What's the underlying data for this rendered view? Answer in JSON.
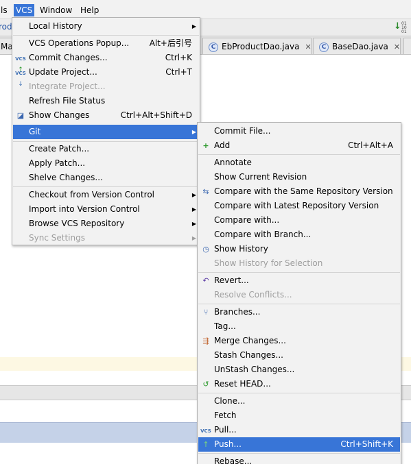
{
  "menubar": {
    "items": [
      "ls",
      "VCS",
      "Window",
      "Help"
    ]
  },
  "tabs": [
    {
      "label": "Ma"
    },
    {
      "label": "EbProductDao.java"
    },
    {
      "label": "BaseDao.java"
    }
  ],
  "toolbar": {
    "partial_label": "rod"
  },
  "vcs_menu": {
    "local_history": "Local History",
    "vcs_operations_popup": "VCS Operations Popup...",
    "vcs_operations_popup_shortcut": "Alt+后引号",
    "commit_changes": "Commit Changes...",
    "commit_changes_shortcut": "Ctrl+K",
    "update_project": "Update Project...",
    "update_project_shortcut": "Ctrl+T",
    "integrate_project": "Integrate Project...",
    "refresh_file_status": "Refresh File Status",
    "show_changes": "Show Changes",
    "show_changes_shortcut": "Ctrl+Alt+Shift+D",
    "git": "Git",
    "create_patch": "Create Patch...",
    "apply_patch": "Apply Patch...",
    "shelve_changes": "Shelve Changes...",
    "checkout": "Checkout from Version Control",
    "import": "Import into Version Control",
    "browse": "Browse VCS Repository",
    "sync_settings": "Sync Settings"
  },
  "git_menu": {
    "commit_file": "Commit File...",
    "add": "Add",
    "add_shortcut": "Ctrl+Alt+A",
    "annotate": "Annotate",
    "show_current_revision": "Show Current Revision",
    "compare_same_repo": "Compare with the Same Repository Version",
    "compare_latest": "Compare with Latest Repository Version",
    "compare_with": "Compare with...",
    "compare_branch": "Compare with Branch...",
    "show_history": "Show History",
    "show_history_selection": "Show History for Selection",
    "revert": "Revert...",
    "resolve_conflicts": "Resolve Conflicts...",
    "branches": "Branches...",
    "tag": "Tag...",
    "merge_changes": "Merge Changes...",
    "stash_changes": "Stash Changes...",
    "unstash_changes": "UnStash Changes...",
    "reset_head": "Reset HEAD...",
    "clone": "Clone...",
    "fetch": "Fetch",
    "pull": "Pull...",
    "push": "Push...",
    "push_shortcut": "Ctrl+Shift+K",
    "rebase": "Rebase..."
  },
  "icons": {
    "vcs_badge": "VCS",
    "toolbar_icon_text": "01\n10\n01"
  },
  "colors": {
    "selection": "#3875d7",
    "menu_bg": "#f2f2f2",
    "disabled": "#9e9e9e"
  }
}
